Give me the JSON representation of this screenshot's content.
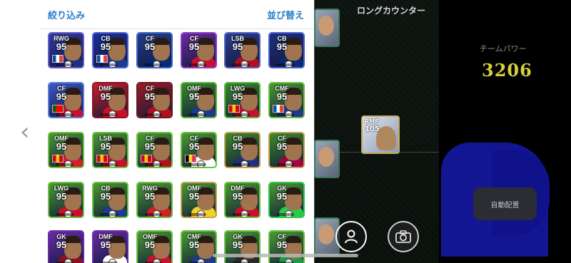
{
  "header": {
    "filter_label": "絞り込み",
    "sort_label": "並び替え"
  },
  "right_panel": {
    "long_counter_label": "ロングカウンター",
    "team_power_label": "チームパワー",
    "team_power_value": "3206",
    "auto_arrange_label": "自動配置"
  },
  "field_player": {
    "position": "RMF",
    "rating": "105"
  },
  "cards": [
    {
      "pos": "RWG",
      "ovr": "95",
      "bg": "#2f3aa8",
      "frame": "#6a5acd",
      "shirt": "#1f2e80",
      "flag": [
        "#0055a4",
        "#ffffff",
        "#ef4135"
      ]
    },
    {
      "pos": "CB",
      "ovr": "95",
      "bg": "#1a2f9a",
      "frame": "#4a5fd8",
      "shirt": "#1e3a8a",
      "flag": [
        "#0055a4",
        "#ffffff",
        "#ef4135"
      ]
    },
    {
      "pos": "CF",
      "ovr": "95",
      "bg": "#253c8c",
      "frame": "#3a66c8",
      "shirt": "#0a2a7a",
      "flag": null
    },
    {
      "pos": "CF",
      "ovr": "95",
      "bg": "#6b2a9a",
      "frame": "#8a3ad0",
      "shirt": "#c8102e",
      "flag": null
    },
    {
      "pos": "LSB",
      "ovr": "95",
      "bg": "#2a3d8f",
      "frame": "#5561c0",
      "shirt": "#b01020",
      "flag": null
    },
    {
      "pos": "CB",
      "ovr": "95",
      "bg": "#1e2f80",
      "frame": "#4a5fd8",
      "shirt": "#0b2a6f",
      "flag": null
    },
    {
      "pos": "CF",
      "ovr": "95",
      "bg": "#3a57c8",
      "frame": "#5b7be0",
      "shirt": "#c8102e",
      "flag": [
        "#006600",
        "#ff0000",
        "#ff0000"
      ]
    },
    {
      "pos": "DMF",
      "ovr": "95",
      "bg": "#c81e2a",
      "frame": "#8a1020",
      "shirt": "#c8102e",
      "flag": null
    },
    {
      "pos": "CF",
      "ovr": "95",
      "bg": "#a01a24",
      "frame": "#6a1a20",
      "shirt": "#b01020",
      "flag": null
    },
    {
      "pos": "OMF",
      "ovr": "95",
      "bg": "#3a8a2e",
      "frame": "#56b53a",
      "shirt": "#1e3a8a",
      "flag": null
    },
    {
      "pos": "LWG",
      "ovr": "95",
      "bg": "#3a8a2e",
      "frame": "#56b53a",
      "shirt": "#c8102e",
      "flag": [
        "#c60b1e",
        "#ffc400",
        "#c60b1e"
      ]
    },
    {
      "pos": "CMF",
      "ovr": "95",
      "bg": "#4a9a32",
      "frame": "#6bc23e",
      "shirt": "#1e3a8a",
      "flag": [
        "#0055a4",
        "#ffffff",
        "#ef4135"
      ]
    },
    {
      "pos": "OMF",
      "ovr": "95",
      "bg": "#4a9a32",
      "frame": "#6bc23e",
      "shirt": "#d21f2a",
      "flag": [
        "#c60b1e",
        "#ffc400",
        "#c60b1e"
      ]
    },
    {
      "pos": "LSB",
      "ovr": "95",
      "bg": "#4a9a32",
      "frame": "#6bc23e",
      "shirt": "#c8102e",
      "flag": [
        "#c60b1e",
        "#ffc400",
        "#c60b1e"
      ]
    },
    {
      "pos": "CF",
      "ovr": "95",
      "bg": "#4a9a32",
      "frame": "#6bc23e",
      "shirt": "#b01020",
      "flag": [
        "#c60b1e",
        "#ffc400",
        "#c60b1e"
      ]
    },
    {
      "pos": "CF",
      "ovr": "95",
      "bg": "#4a9a32",
      "frame": "#6bc23e",
      "shirt": "#ffffff",
      "flag": [
        "#000000",
        "#fdda24",
        "#ef3340"
      ]
    },
    {
      "pos": "CB",
      "ovr": "95",
      "bg": "#3d8a2c",
      "frame": "#c9a04a",
      "shirt": "#1e2e80",
      "flag": null
    },
    {
      "pos": "CF",
      "ovr": "95",
      "bg": "#3d8a2c",
      "frame": "#c9a04a",
      "shirt": "#a50044",
      "flag": null
    },
    {
      "pos": "LWG",
      "ovr": "95",
      "bg": "#4a9a32",
      "frame": "#6bc23e",
      "shirt": "#c8102e",
      "flag": null
    },
    {
      "pos": "CB",
      "ovr": "95",
      "bg": "#4a9a32",
      "frame": "#6bc23e",
      "shirt": "#1e3a8a",
      "flag": null
    },
    {
      "pos": "RWG",
      "ovr": "95",
      "bg": "#4a9a32",
      "frame": "#6bc23e",
      "shirt": "#d41f26",
      "flag": null
    },
    {
      "pos": "OMF",
      "ovr": "95",
      "bg": "#4a9a32",
      "frame": "#c9a04a",
      "shirt": "#f2d22a",
      "flag": null
    },
    {
      "pos": "DMF",
      "ovr": "95",
      "bg": "#4a9a32",
      "frame": "#6bc23e",
      "shirt": "#c8102e",
      "flag": null
    },
    {
      "pos": "GK",
      "ovr": "95",
      "bg": "#4a9a32",
      "frame": "#2ec84a",
      "shirt": "#2ec84a",
      "flag": null
    },
    {
      "pos": "GK",
      "ovr": "95",
      "bg": "#6a2aa8",
      "frame": "#6a2aa8",
      "shirt": "#8a1020",
      "flag": null
    },
    {
      "pos": "DMF",
      "ovr": "95",
      "bg": "#6a2aa8",
      "frame": "#6a2aa8",
      "shirt": "#ffffff",
      "flag": null
    },
    {
      "pos": "OMF",
      "ovr": "95",
      "bg": "#4a9a32",
      "frame": "#6bc23e",
      "shirt": "#c8102e",
      "flag": null
    },
    {
      "pos": "CMF",
      "ovr": "95",
      "bg": "#4a9a32",
      "frame": "#6bc23e",
      "shirt": "#1e3a8a",
      "flag": null
    },
    {
      "pos": "GK",
      "ovr": "95",
      "bg": "#4a9a32",
      "frame": "#6bc23e",
      "shirt": "#2a2a2a",
      "flag": null
    },
    {
      "pos": "CF",
      "ovr": "95",
      "bg": "#4a9a32",
      "frame": "#6bc23e",
      "shirt": "#1e9a4a",
      "flag": null
    }
  ],
  "icons": {
    "back": "chevron-left-icon",
    "person": "person-icon",
    "camera": "camera-icon"
  }
}
